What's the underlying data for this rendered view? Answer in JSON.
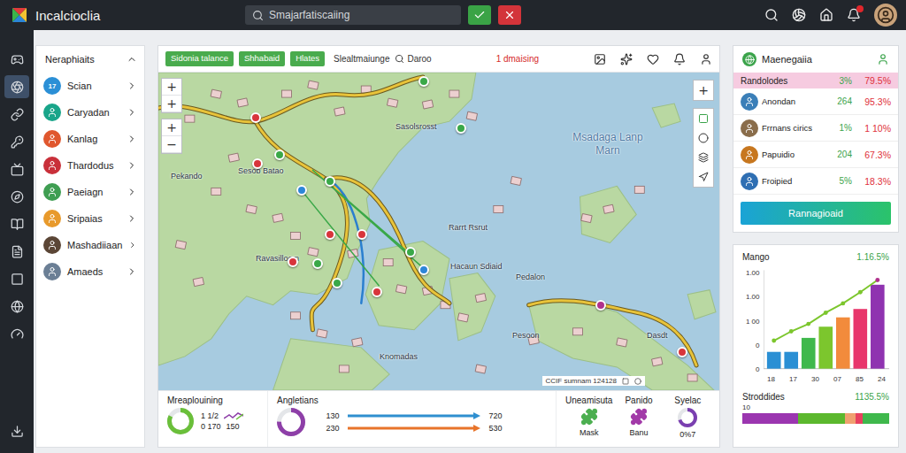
{
  "app": {
    "title": "Incalcioclia"
  },
  "search": {
    "value": "Smajarfatiscaiing"
  },
  "notifications": {
    "unread": true
  },
  "rail": {
    "items": [
      {
        "selected": false
      },
      {
        "selected": true
      },
      {
        "selected": false
      },
      {
        "selected": false
      },
      {
        "selected": false
      },
      {
        "selected": false
      },
      {
        "selected": false
      },
      {
        "selected": false
      },
      {
        "selected": false
      },
      {
        "selected": false
      },
      {
        "selected": false
      }
    ]
  },
  "sidebar": {
    "title": "Neraphiaits",
    "expanded": true,
    "items": [
      {
        "label": "Scian",
        "badge": "17",
        "color": "#2b8fd6"
      },
      {
        "label": "Caryadan",
        "color": "#19a58a"
      },
      {
        "label": "Kanlag",
        "color": "#e0572e"
      },
      {
        "label": "Thardodus",
        "color": "#c9303a"
      },
      {
        "label": "Paeiagn",
        "color": "#3f9e52"
      },
      {
        "label": "Sripaias",
        "color": "#e89a2c"
      },
      {
        "label": "Mashadiiaan",
        "color": "#5b4636"
      },
      {
        "label": "Amaeds",
        "color": "#6b7f95"
      }
    ]
  },
  "map": {
    "tags": [
      "Sidonia talance",
      "Shhabaid",
      "Hlates"
    ],
    "label": "Slealtmaiunge",
    "search": "Daroo",
    "alert": "1 dmaising",
    "zoom": [
      [
        "+",
        "+"
      ],
      [
        "+",
        "−"
      ]
    ],
    "tool": "+",
    "places": [
      "Msadaga Lanp Marn",
      "Pekando",
      "Sesob Batao",
      "Sasolsrosst",
      "Rarrt Rsrut",
      "Ravasilloom",
      "Hacaun Sdiaid",
      "Pedalon",
      "Pesoon",
      "Dasdt",
      "Knomadas"
    ],
    "pins": [
      {
        "color": "#d8353c"
      },
      {
        "color": "#3aa848"
      },
      {
        "color": "#2d86d8"
      },
      {
        "color": "#3aa848"
      },
      {
        "color": "#d8353c"
      },
      {
        "color": "#d8353c"
      },
      {
        "color": "#2d86d8"
      },
      {
        "color": "#d8353c"
      },
      {
        "color": "#3aa848"
      },
      {
        "color": "#d8353c"
      },
      {
        "color": "#3aa848"
      },
      {
        "color": "#3aa848"
      },
      {
        "color": "#b0318c"
      },
      {
        "color": "#d8353c"
      },
      {
        "color": "#d8353c"
      },
      {
        "color": "#3aa848"
      },
      {
        "color": "#3aa848"
      }
    ],
    "scale": "CCIF sumnam 124128"
  },
  "summary": {
    "gauge": {
      "title": "Mreaplouining",
      "level": 0.82,
      "color": "#6abf3a",
      "readings": [
        "1 1/2",
        "0 170",
        "150"
      ]
    },
    "trend": {
      "title": "Angletians",
      "level": 0.75,
      "color": "#8e3fa8",
      "lines": [
        {
          "start": "130",
          "end": "720",
          "color": "#2f8fd0"
        },
        {
          "start": "230",
          "end": "530",
          "color": "#e8742a"
        }
      ]
    },
    "tiles": [
      {
        "kind": "puzzle",
        "title": "Uneamisuta",
        "caption": "Mask",
        "color": "#4caf50"
      },
      {
        "kind": "puzzle",
        "title": "Panido",
        "caption": "Banu",
        "color": "#a23aa8"
      },
      {
        "kind": "ring",
        "title": "Syelac",
        "caption": "0%7",
        "level": 0.7,
        "color": "#7a3fb0"
      }
    ]
  },
  "manager": {
    "title": "Maenegaiia",
    "header": {
      "name": "Randolodes",
      "count": "3%",
      "share": "79.5%"
    },
    "rows": [
      {
        "name": "Anondan",
        "count": "264",
        "share": "95.3%",
        "color": "#3b7fb8"
      },
      {
        "name": "Frrnans cirics",
        "count": "1%",
        "share": "1 10%",
        "color": "#8a6d4b"
      },
      {
        "name": "Papuidio",
        "count": "204",
        "share": "67.3%",
        "color": "#c7771f"
      },
      {
        "name": "Froipied",
        "count": "5%",
        "share": "18.3%",
        "color": "#2f6fb3"
      }
    ],
    "button": "Rannagioaid"
  },
  "chart": {
    "title": "Mango",
    "value": "1.16.5%",
    "y_ticks": [
      "1.00",
      "1.00",
      "1 00",
      "0",
      "0"
    ],
    "x_labels": [
      "18",
      "17",
      "30",
      "07",
      "85",
      "24"
    ],
    "bars": [
      {
        "value": 18,
        "color": "#2a8fd4"
      },
      {
        "value": 18,
        "color": "#2a8fd4"
      },
      {
        "value": 33,
        "color": "#3fb84c"
      },
      {
        "value": 45,
        "color": "#7cc62d"
      },
      {
        "value": 55,
        "color": "#f28b3c"
      },
      {
        "value": 64,
        "color": "#e8366b"
      },
      {
        "value": 90,
        "color": "#8f33b0"
      }
    ],
    "line": [
      30,
      40,
      48,
      60,
      70,
      82,
      95
    ]
  },
  "progress": {
    "title": "Stroddides",
    "value": "1135.5%",
    "tick": "10",
    "segments": [
      {
        "level": 0.38,
        "color": "#9b36b0"
      },
      {
        "level": 0.32,
        "color": "#5cb82e"
      },
      {
        "level": 0.07,
        "color": "#f0a070"
      },
      {
        "level": 0.05,
        "color": "#e84060"
      },
      {
        "level": 0.18,
        "color": "#3fb84c"
      }
    ]
  }
}
